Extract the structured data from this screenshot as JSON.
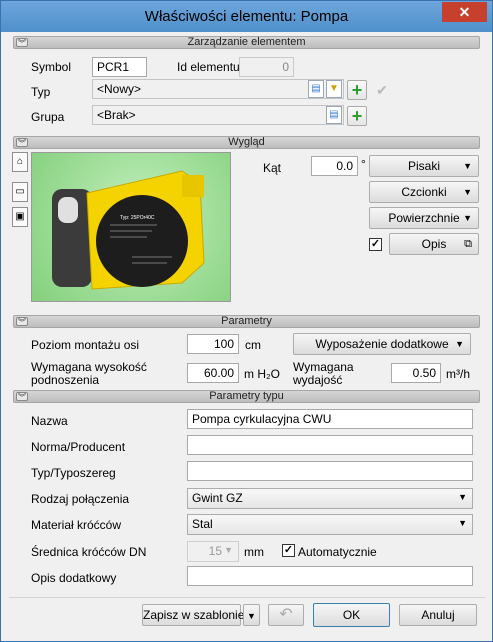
{
  "window": {
    "title": "Właściwości elementu: Pompa",
    "close_glyph": "✕"
  },
  "sections": {
    "management": "Zarządzanie elementem",
    "appearance": "Wygląd",
    "parameters": "Parametry",
    "type_parameters": "Parametry typu"
  },
  "management": {
    "symbol_label": "Symbol",
    "symbol_value": "PCR1",
    "id_label": "Id elementu",
    "id_value": "0",
    "type_label": "Typ",
    "type_value": "<Nowy>",
    "group_label": "Grupa",
    "group_value": "<Brak>"
  },
  "appearance": {
    "angle_label": "Kąt",
    "angle_value": "0.0",
    "angle_unit": "°",
    "pens_button": "Pisaki",
    "fonts_button": "Czcionki",
    "surfaces_button": "Powierzchnie",
    "description_button": "Opis",
    "description_checked": true,
    "pump_label": "Typ: 25POr40C"
  },
  "parameters": {
    "mount_level_label": "Poziom montażu osi",
    "mount_level_value": "100",
    "mount_level_unit": "cm",
    "extra_equipment_button": "Wyposażenie dodatkowe",
    "head_label_line1": "Wymagana wysokość",
    "head_label_line2": "podnoszenia",
    "head_value": "60.00",
    "head_unit": "m H₂O",
    "flow_label_line1": "Wymagana",
    "flow_label_line2": "wydajość",
    "flow_value": "0.50",
    "flow_unit": "m³/h"
  },
  "type_parameters": {
    "name_label": "Nazwa",
    "name_value": "Pompa cyrkulacyjna CWU",
    "producer_label": "Norma/Producent",
    "producer_value": "",
    "series_label": "Typ/Typoszereg",
    "series_value": "",
    "connection_label": "Rodzaj połączenia",
    "connection_value": "Gwint GZ",
    "material_label": "Materiał króćców",
    "material_value": "Stal",
    "diameter_label": "Średnica króćców DN",
    "diameter_value": "15",
    "diameter_unit": "mm",
    "auto_label": "Automatycznie",
    "auto_checked": true,
    "extra_desc_label": "Opis dodatkowy",
    "extra_desc_value": ""
  },
  "footer": {
    "save_template_button": "Zapisz w szablonie",
    "ok_button": "OK",
    "cancel_button": "Anuluj"
  }
}
